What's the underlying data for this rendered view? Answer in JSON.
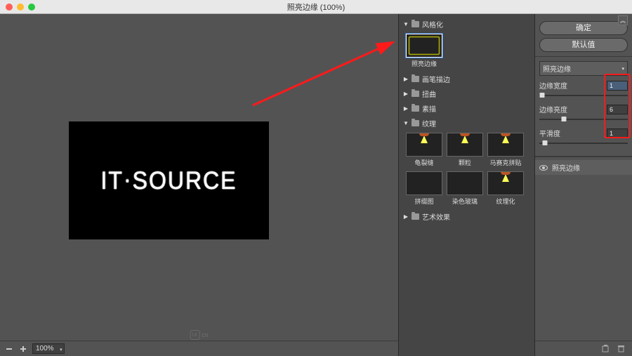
{
  "window": {
    "title": "照亮边缘 (100%)"
  },
  "preview": {
    "text": "IT·SOURCE",
    "zoom": "100%"
  },
  "categories": {
    "stylize": {
      "label": "风格化",
      "expanded": true,
      "thumbs": [
        {
          "label": "照亮边缘",
          "selected": true
        }
      ]
    },
    "brush": {
      "label": "画笔描边",
      "expanded": false
    },
    "distort": {
      "label": "扭曲",
      "expanded": false
    },
    "sketch": {
      "label": "素描",
      "expanded": false
    },
    "texture": {
      "label": "纹理",
      "expanded": true,
      "thumbs": [
        {
          "label": "龟裂缝"
        },
        {
          "label": "颗粒"
        },
        {
          "label": "马赛克拼贴"
        },
        {
          "label": "拼缀图"
        },
        {
          "label": "染色玻璃"
        },
        {
          "label": "纹理化"
        }
      ]
    },
    "artistic": {
      "label": "艺术效果",
      "expanded": false
    }
  },
  "side": {
    "ok": "确定",
    "defaults": "默认值",
    "preset_name": "照亮边缘",
    "params": {
      "edge_width": {
        "label": "边缘宽度",
        "value": "1",
        "pos": 3
      },
      "edge_bright": {
        "label": "边缘亮度",
        "value": "6",
        "pos": 28
      },
      "smoothness": {
        "label": "平滑度",
        "value": "1",
        "pos": 6
      }
    },
    "layer": "照亮边缘"
  },
  "watermark": "cn"
}
